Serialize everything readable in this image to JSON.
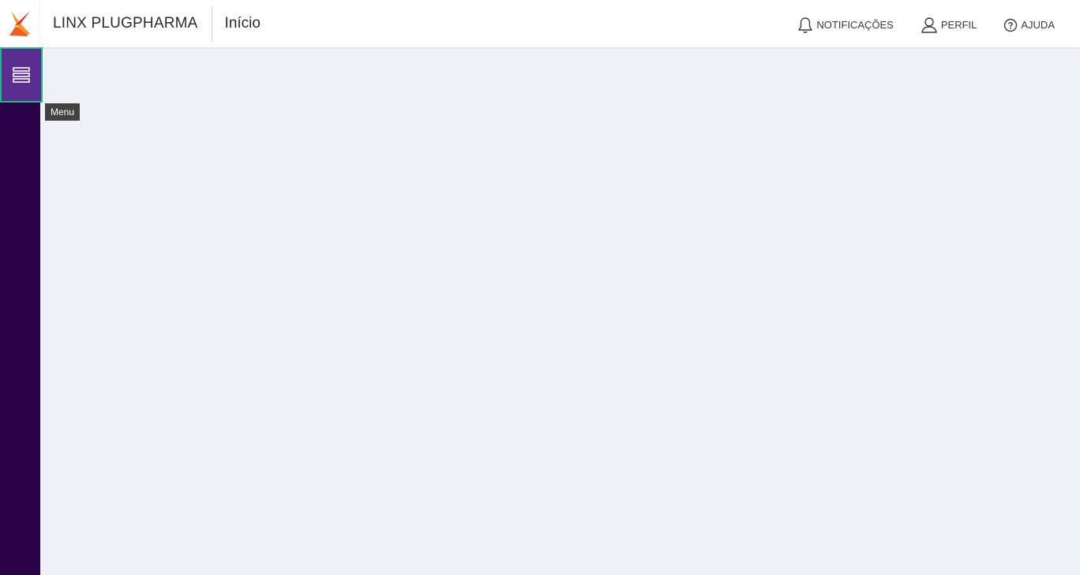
{
  "header": {
    "app_name": "LINX PLUGPHARMA",
    "page_title": "Início",
    "actions": [
      {
        "label": "NOTIFICAÇÕES",
        "icon": "bell-icon"
      },
      {
        "label": "PERFIL",
        "icon": "user-icon"
      },
      {
        "label": "AJUDA",
        "icon": "help-circle-icon"
      }
    ]
  },
  "sidebar": {
    "menu_button_icon": "menu-icon",
    "menu_tooltip": "Menu"
  },
  "colors": {
    "sidebar_bg": "#2a0248",
    "menu_button_bg": "#5c2d91",
    "focus_border": "#1fb88a",
    "content_bg": "#f0f1f6",
    "logo_orange": "#f7931e",
    "logo_red": "#e8262a"
  }
}
